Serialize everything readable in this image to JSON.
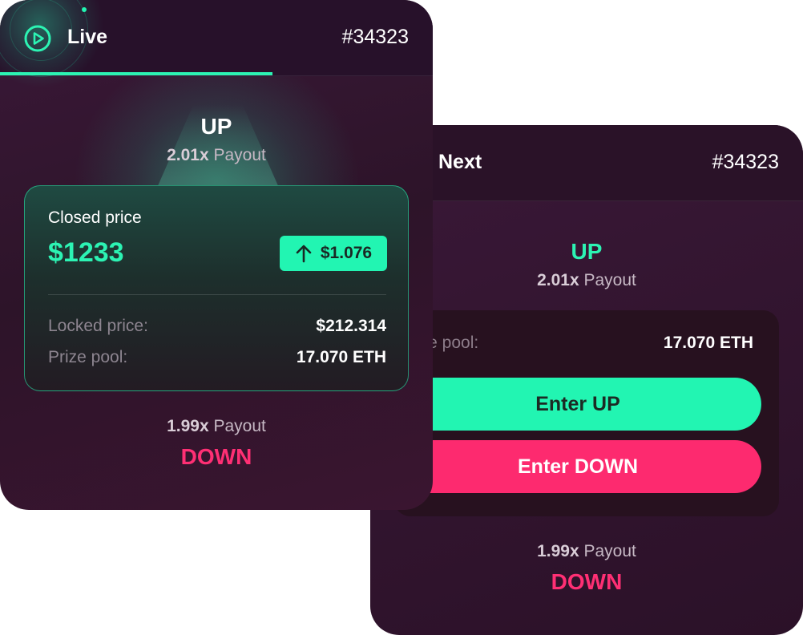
{
  "live_card": {
    "round_label": "Live",
    "round_id": "#34323",
    "round_progress": 0.63,
    "up": {
      "title": "UP",
      "multiplier": "2.01x",
      "payout_word": "Payout"
    },
    "closed_label": "Closed price",
    "closed_value": "$1233",
    "change_value": "$1.076",
    "change_icon": "arrow-up-icon",
    "locked_label": "Locked price:",
    "locked_value": "$212.314",
    "pool_label": "Prize pool:",
    "pool_value": "17.070 ETH",
    "down": {
      "title": "DOWN",
      "multiplier": "1.99x",
      "payout_word": "Payout"
    }
  },
  "next_card": {
    "round_label": "Next",
    "round_id": "#34323",
    "up": {
      "title": "UP",
      "multiplier": "2.01x",
      "payout_word": "Payout"
    },
    "pool_label": "rize pool:",
    "pool_value": "17.070 ETH",
    "enter_up_label": "Enter UP",
    "enter_down_label": "Enter DOWN",
    "down": {
      "title": "DOWN",
      "multiplier": "1.99x",
      "payout_word": "Payout"
    }
  },
  "colors": {
    "accent_green": "#22f5b2",
    "accent_pink": "#fd2a6f",
    "card_bg": "#331530"
  }
}
